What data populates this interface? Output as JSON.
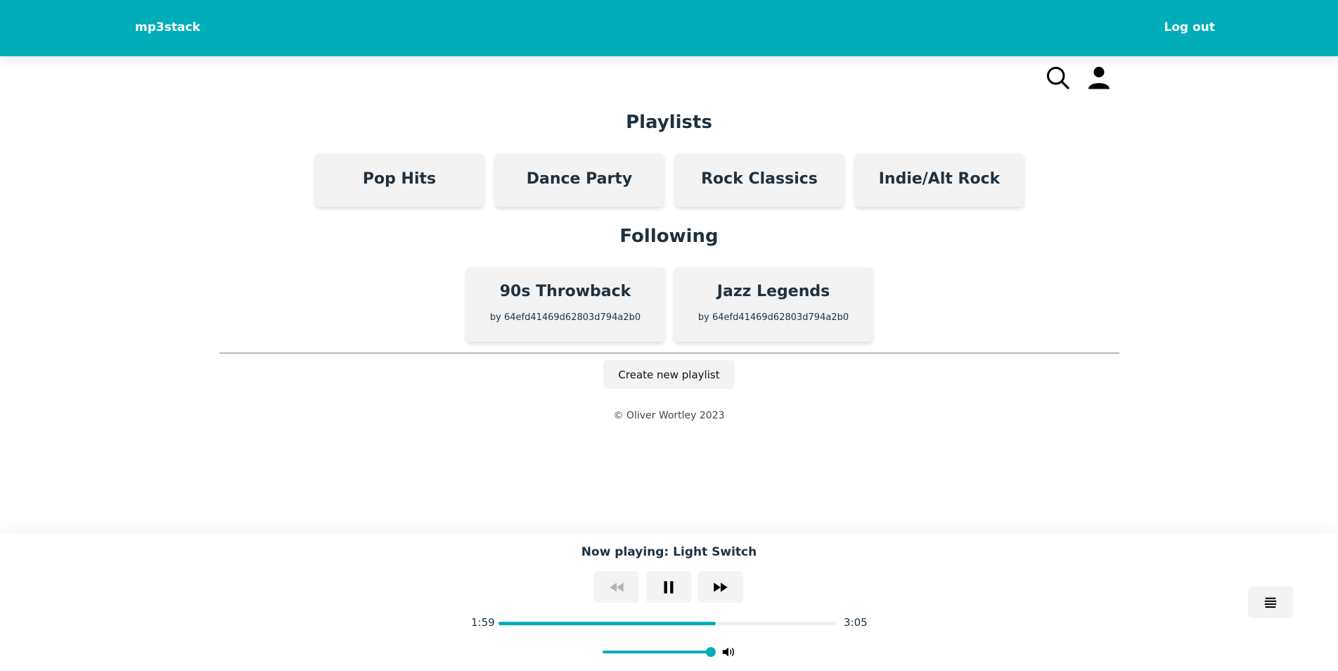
{
  "header": {
    "brand": "mp3stack",
    "logout_label": "Log out"
  },
  "icons": {
    "search": "search-icon",
    "user": "user-icon",
    "rewind": "rewind-icon",
    "pause": "pause-icon",
    "fast_forward": "fast-forward-icon",
    "volume": "volume-icon",
    "queue": "queue-list-icon"
  },
  "playlists": {
    "title": "Playlists",
    "items": [
      {
        "name": "Pop Hits"
      },
      {
        "name": "Dance Party"
      },
      {
        "name": "Rock Classics"
      },
      {
        "name": "Indie/Alt Rock"
      }
    ]
  },
  "following": {
    "title": "Following",
    "items": [
      {
        "name": "90s Throwback",
        "owner": "by 64efd41469d62803d794a2b0"
      },
      {
        "name": "Jazz Legends",
        "owner": "by 64efd41469d62803d794a2b0"
      }
    ]
  },
  "actions": {
    "create_playlist_label": "Create new playlist"
  },
  "footer": {
    "copyright": "© Oliver Wortley 2023"
  },
  "player": {
    "now_playing": "Now playing: Light Switch",
    "elapsed": "1:59",
    "duration": "3:05",
    "progress_percent": 64.3,
    "volume_percent": 100,
    "rewind_disabled": true
  },
  "colors": {
    "accent": "#00aeb9",
    "text": "#1f3140",
    "card_bg": "#f3f3f3"
  }
}
